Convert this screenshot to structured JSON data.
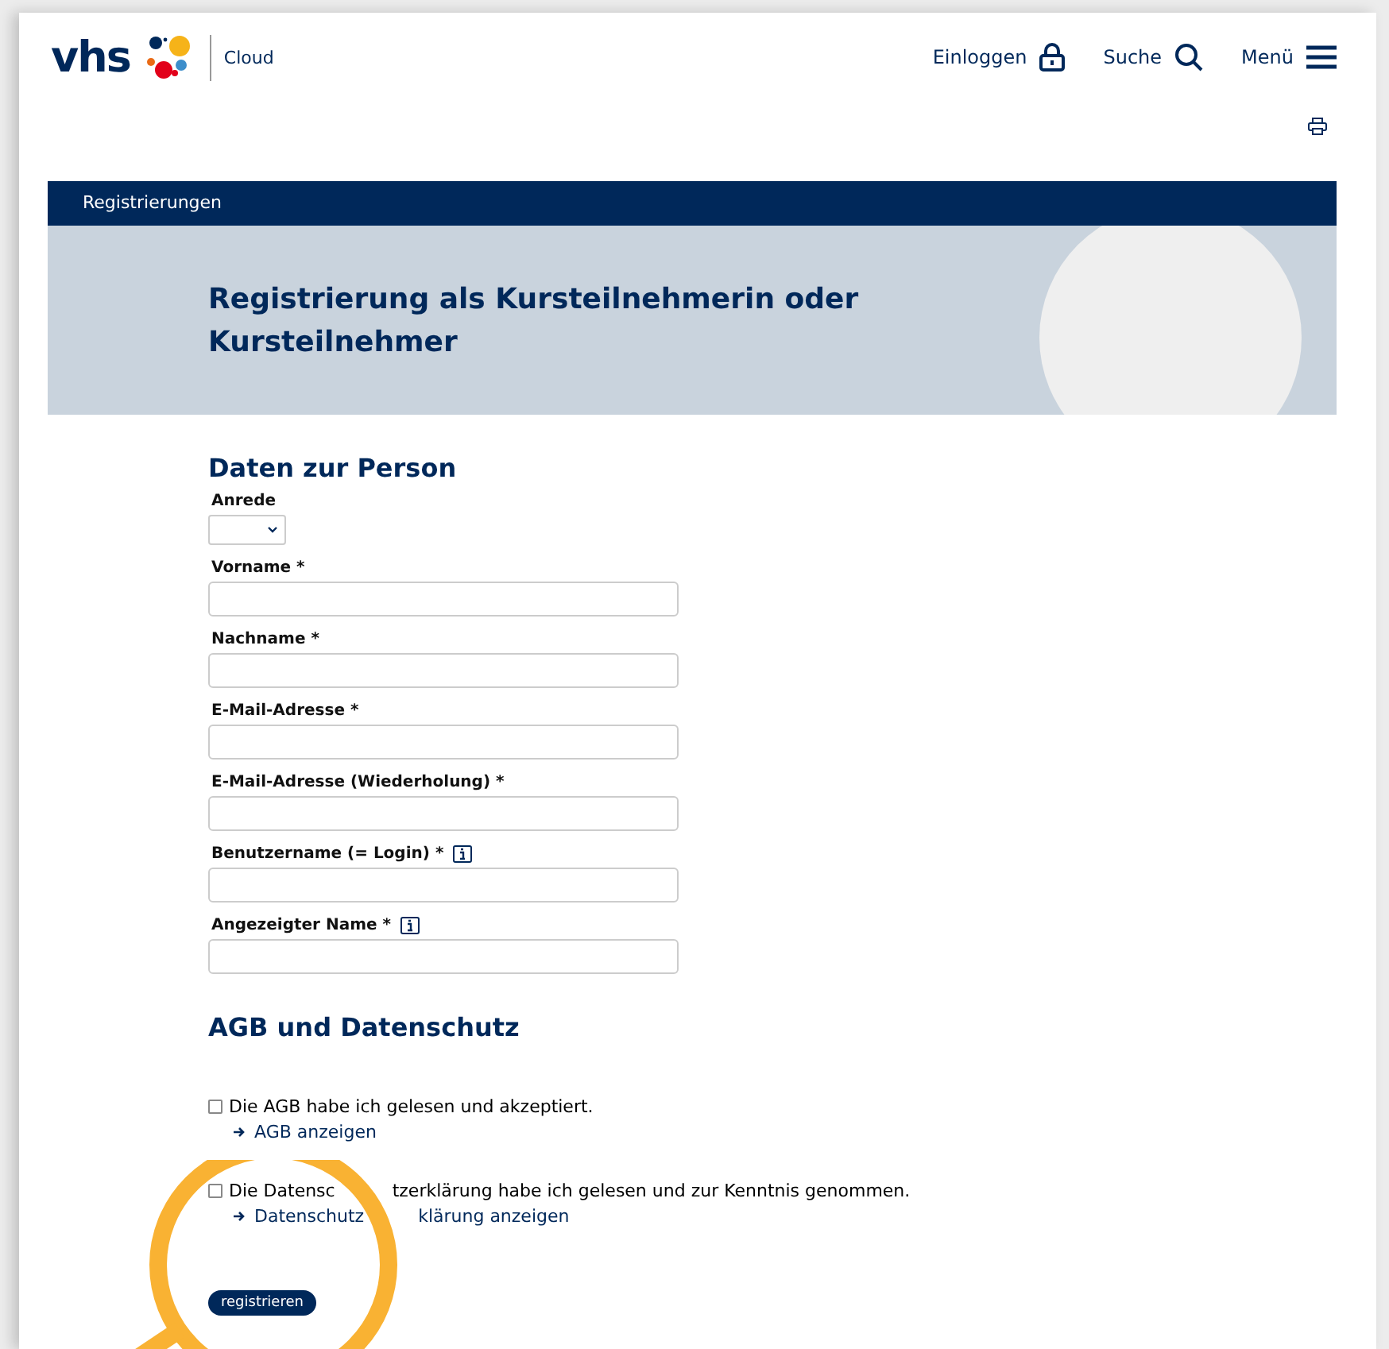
{
  "header": {
    "logo": "vhs",
    "product": "Cloud",
    "nav": [
      {
        "label": "Einloggen",
        "kind": "lock"
      },
      {
        "label": "Suche",
        "kind": "search"
      },
      {
        "label": "Menü",
        "kind": "menu"
      }
    ]
  },
  "breadcrumb": "Registrierungen",
  "title": "Registrierung als Kursteilnehmerin oder Kursteilnehmer",
  "person": {
    "heading": "Daten zur Person",
    "fields": [
      {
        "label": "Anrede",
        "kind": "select",
        "info": false
      },
      {
        "label": "Vorname *",
        "kind": "text",
        "info": false
      },
      {
        "label": "Nachname *",
        "kind": "text",
        "info": false
      },
      {
        "label": "E-Mail-Adresse *",
        "kind": "text",
        "info": false
      },
      {
        "label": "E-Mail-Adresse (Wiederholung) *",
        "kind": "text",
        "info": false
      },
      {
        "label": "Benutzername (= Login) *",
        "kind": "text",
        "info": true
      },
      {
        "label": "Angezeigter Name *",
        "kind": "text",
        "info": true
      }
    ]
  },
  "terms": {
    "heading": "AGB und Datenschutz",
    "consents": [
      {
        "text": [
          "Die AGB habe ich gelesen und akzeptiert."
        ],
        "checked": false,
        "link": [
          "AGB anzeigen"
        ]
      },
      {
        "text": [
          "Die Datensc",
          "tzerklärung habe ich gelesen und zur Kenntnis genommen."
        ],
        "checked": false,
        "link": [
          "Datenschutz",
          "klärung anzeigen"
        ]
      }
    ]
  },
  "submit": "registrieren"
}
